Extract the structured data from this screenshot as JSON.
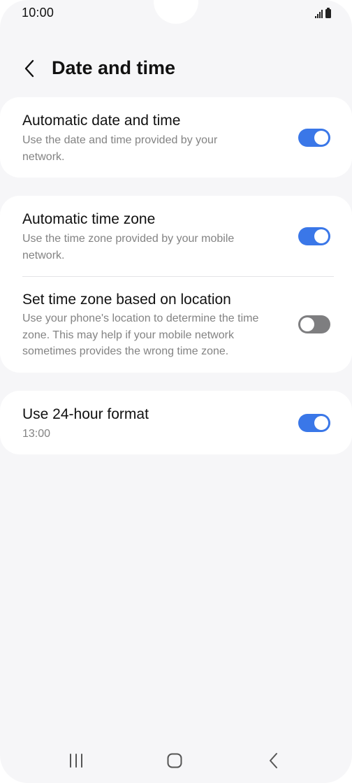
{
  "status_bar": {
    "time": "10:00",
    "icons": [
      "signal-icon",
      "battery-icon"
    ]
  },
  "header": {
    "back_icon": "chevron-left-icon",
    "title": "Date and time"
  },
  "settings": {
    "automatic_date_time": {
      "title": "Automatic date and time",
      "description": "Use the date and time provided by your network.",
      "enabled": true
    },
    "automatic_time_zone": {
      "title": "Automatic time zone",
      "description": "Use the time zone provided by your mobile network.",
      "enabled": true
    },
    "time_zone_location": {
      "title": "Set time zone based on location",
      "description": "Use your phone's location to determine the time zone. This may help if your mobile network sometimes provides the wrong time zone.",
      "enabled": false
    },
    "use_24_hour": {
      "title": "Use 24-hour format",
      "description": "13:00",
      "enabled": true
    }
  },
  "colors": {
    "toggle_on": "#3a77e8",
    "toggle_off": "#7e7e80",
    "background": "#f6f6f8",
    "card": "#ffffff"
  },
  "nav_bar": {
    "icons": [
      "recents-icon",
      "home-icon",
      "back-icon"
    ]
  }
}
